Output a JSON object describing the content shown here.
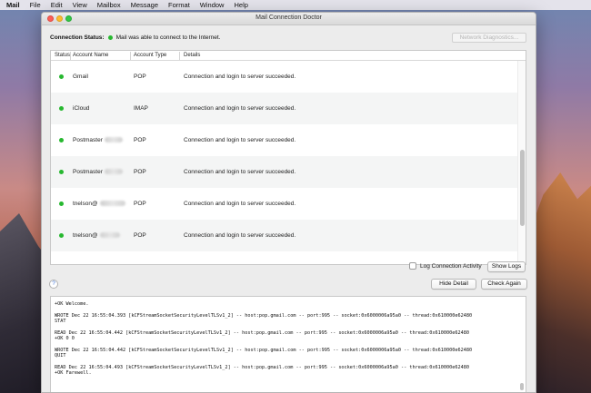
{
  "menubar": {
    "app": "Mail",
    "items": [
      "File",
      "Edit",
      "View",
      "Mailbox",
      "Message",
      "Format",
      "Window",
      "Help"
    ]
  },
  "window": {
    "title": "Mail Connection Doctor",
    "connection_status_label": "Connection Status:",
    "connection_status_text": "Mail was able to connect to the Internet.",
    "network_diagnostics_label": "Network Diagnostics..."
  },
  "table": {
    "headers": {
      "status": "Status",
      "account_name": "Account Name",
      "account_type": "Account Type",
      "details": "Details"
    },
    "rows": [
      {
        "name": "Gmail",
        "type": "POP",
        "details": "Connection and login to server succeeded."
      },
      {
        "name": "iCloud",
        "type": "IMAP",
        "details": "Connection and login to server succeeded."
      },
      {
        "name": "Postmaster",
        "type": "POP",
        "details": "Connection and login to server succeeded."
      },
      {
        "name": "Postmaster",
        "type": "POP",
        "details": "Connection and login to server succeeded."
      },
      {
        "name": "tnelson@",
        "type": "POP",
        "details": "Connection and login to server succeeded."
      },
      {
        "name": "tnelson@",
        "type": "POP",
        "details": "Connection and login to server succeeded."
      }
    ]
  },
  "controls": {
    "log_connection_activity": "Log Connection Activity",
    "show_logs": "Show Logs",
    "hide_detail": "Hide Detail",
    "check_again": "Check Again",
    "help": "?"
  },
  "log": {
    "lines": [
      "+OK Welcome.",
      "WROTE Dec 22 16:55:04.393 [kCFStreamSocketSecurityLevelTLSv1_2] -- host:pop.gmail.com -- port:995 -- socket:0x6000006a95a0 -- thread:0x610000e62480",
      "STAT",
      "READ Dec 22 16:55:04.442 [kCFStreamSocketSecurityLevelTLSv1_2] -- host:pop.gmail.com -- port:995 -- socket:0x6000006a95a0 -- thread:0x610000e62480",
      "+OK 0 0",
      "WROTE Dec 22 16:55:04.442 [kCFStreamSocketSecurityLevelTLSv1_2] -- host:pop.gmail.com -- port:995 -- socket:0x6000006a95a0 -- thread:0x610000e62480",
      "QUIT",
      "READ Dec 22 16:55:04.493 [kCFStreamSocketSecurityLevelTLSv1_2] -- host:pop.gmail.com -- port:995 -- socket:0x6000006a95a0 -- thread:0x610000e62480",
      "+OK Farewell."
    ]
  },
  "colors": {
    "status_ok": "#27b830",
    "close": "#fc5f57",
    "minimize": "#fdbc2e",
    "maximize": "#33c748"
  }
}
